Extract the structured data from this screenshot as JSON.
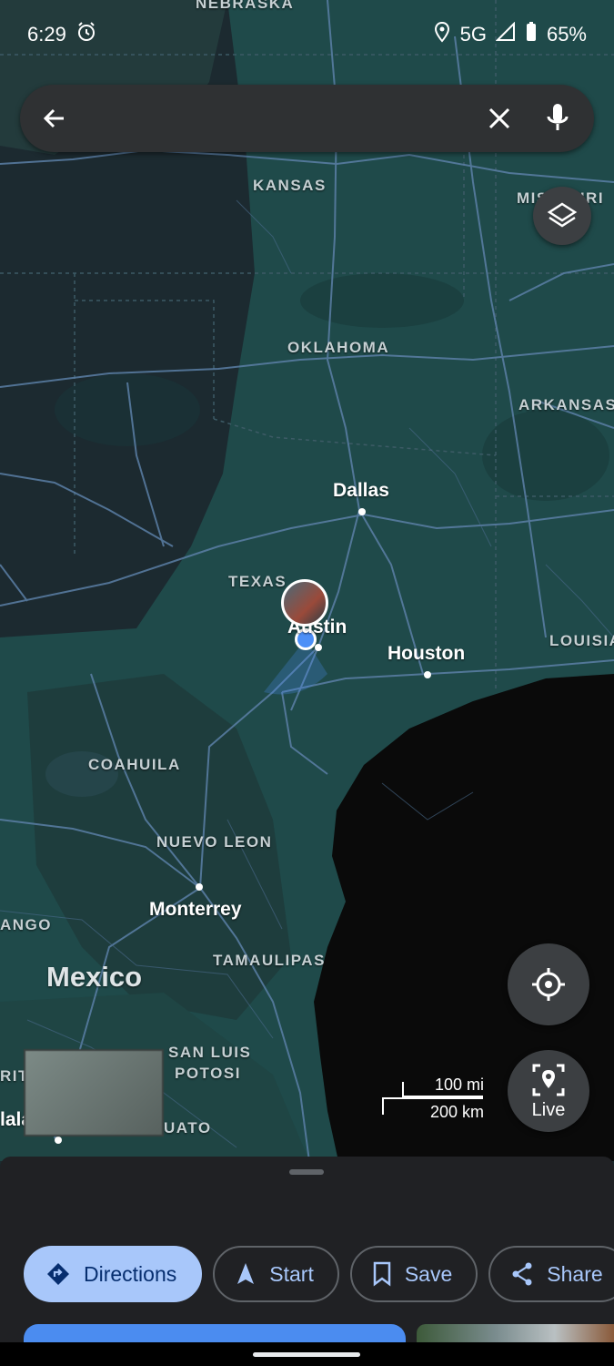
{
  "status_bar": {
    "time": "6:29",
    "network": "5G",
    "battery": "65%"
  },
  "search": {
    "value": "",
    "placeholder": ""
  },
  "map_labels": {
    "states": [
      "NEBRASKA",
      "KANSAS",
      "MISSOURI",
      "OKLAHOMA",
      "ARKANSAS",
      "TEXAS",
      "LOUISIA",
      "COAHUILA",
      "NUEVO LEON",
      "TAMAULIPAS",
      "SAN LUIS",
      "POTOSI",
      "ANGO",
      "RIT",
      "UATO"
    ],
    "cities": [
      "Dallas",
      "Austin",
      "Houston",
      "Monterrey",
      "lala"
    ],
    "country": "Mexico"
  },
  "scale": {
    "miles": "100 mi",
    "km": "200 km"
  },
  "live_button": {
    "label": "Live"
  },
  "actions": [
    {
      "label": "Directions",
      "icon": "directions-icon"
    },
    {
      "label": "Start",
      "icon": "navigation-arrow-icon"
    },
    {
      "label": "Save",
      "icon": "bookmark-icon"
    },
    {
      "label": "Share",
      "icon": "share-icon"
    }
  ],
  "colors": {
    "land": "#1f4a4a",
    "land_dark": "#1c2a30",
    "water": "#0a0a0a",
    "roads": "#5b7fa6",
    "accent": "#a8c7fa",
    "location_dot": "#4c8ff7"
  }
}
